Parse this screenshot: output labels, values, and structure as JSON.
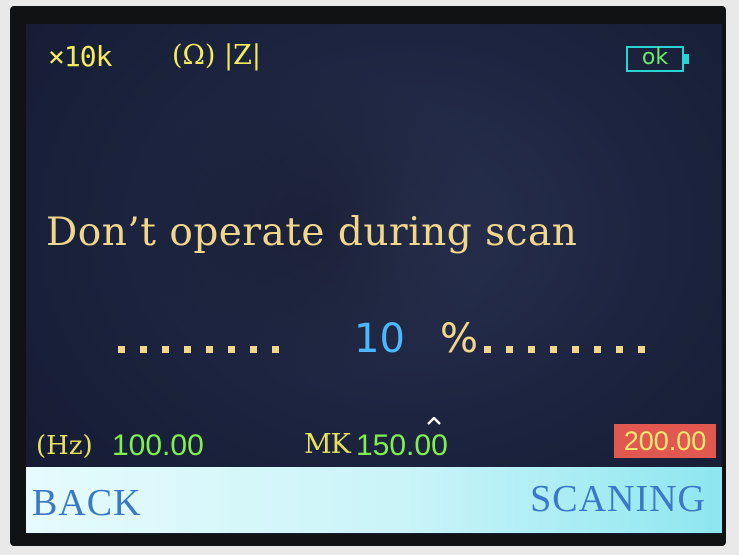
{
  "status": {
    "range": "×10k",
    "unit": "(Ω) |Z|",
    "battery": "ok"
  },
  "message": {
    "warning": "Don’t operate during scan"
  },
  "progress": {
    "value": "10",
    "unit": "%",
    "percent": 10
  },
  "readouts": {
    "freq_label": "(Hz)",
    "freq_value": "100.00",
    "marker_label": "MK",
    "marker_value": "150.00",
    "end_freq": "200.00"
  },
  "softkeys": {
    "left": "BACK",
    "right": "SCANING"
  },
  "colors": {
    "screen_bg": "#1c2440",
    "label_yellow": "#f4ec5a",
    "value_green": "#7ff04c",
    "progress_blue": "#4ab7ff",
    "highlight_red": "#e0584e",
    "softkey_bar": "#c9f4f8",
    "softkey_text": "#3a78c8"
  },
  "icons": {
    "battery": "battery-icon",
    "marker": "caret-up-icon"
  }
}
